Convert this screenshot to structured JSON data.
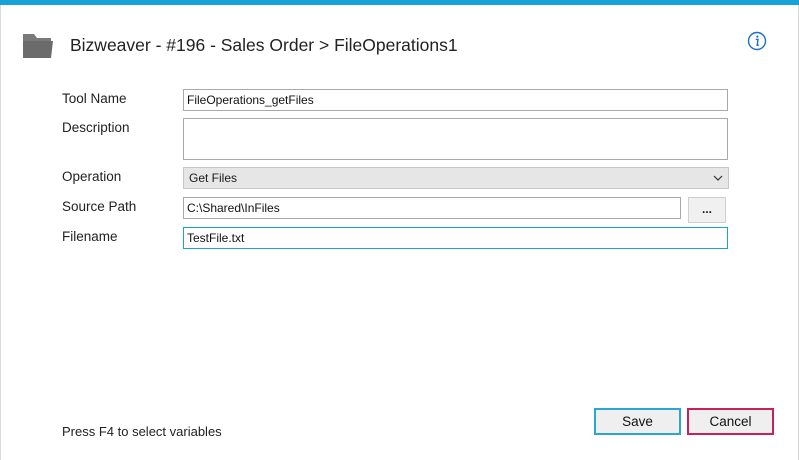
{
  "theme": {
    "accent": "#1aa3cc",
    "topbar_color": "#18a3d6",
    "save_border": "#2aa7d0",
    "cancel_border": "#c8205a",
    "icon_color": "#6b6b6b",
    "info_color": "#1a6fc6"
  },
  "header": {
    "icon": "folder-icon",
    "title": "Bizweaver - #196 - Sales Order > FileOperations1",
    "info_icon": "info-icon"
  },
  "form": {
    "tool_name": {
      "label": "Tool Name",
      "value": "FileOperations_getFiles"
    },
    "description": {
      "label": "Description",
      "value": ""
    },
    "operation": {
      "label": "Operation",
      "value": "Get Files",
      "icon": "chevron-down-icon"
    },
    "source_path": {
      "label": "Source Path",
      "value": "C:\\Shared\\InFiles",
      "browse_label": "..."
    },
    "filename": {
      "label": "Filename",
      "value": "TestFile.txt"
    }
  },
  "footer": {
    "hint": "Press F4 to select variables",
    "save_label": "Save",
    "cancel_label": "Cancel"
  }
}
